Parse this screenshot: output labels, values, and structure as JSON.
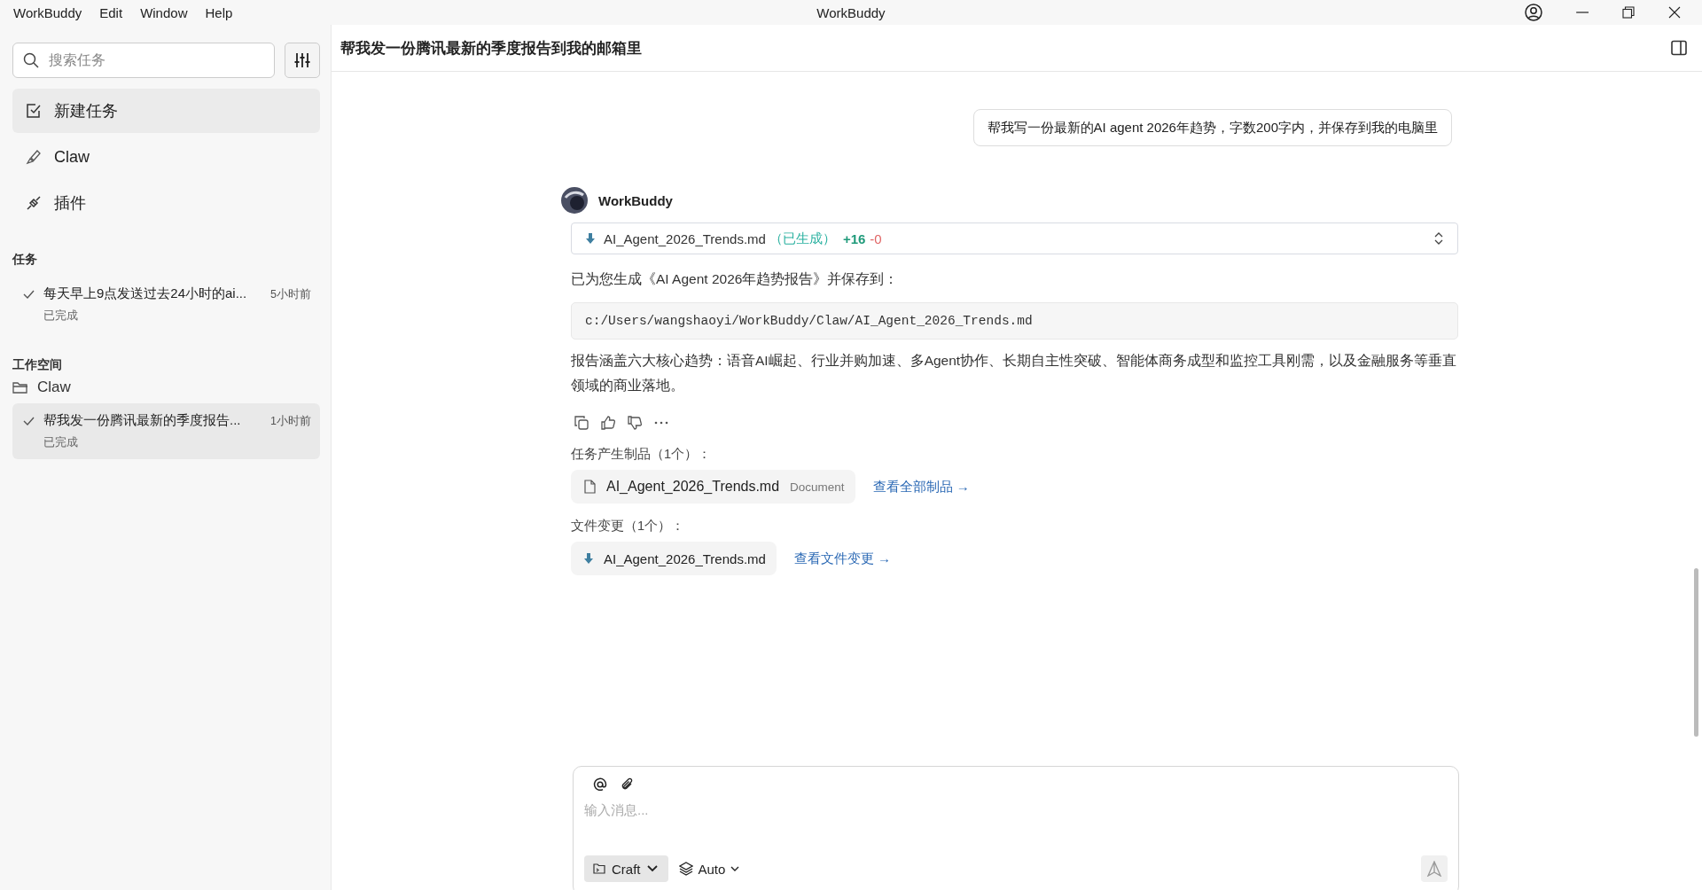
{
  "menu": [
    "WorkBuddy",
    "Edit",
    "Window",
    "Help"
  ],
  "window": {
    "title": "WorkBuddy"
  },
  "sidebar": {
    "search": {
      "placeholder": "搜索任务"
    },
    "nav": [
      {
        "kind": "new-task",
        "label": "新建任务",
        "selected": true
      },
      {
        "kind": "claw",
        "label": "Claw",
        "selected": false
      },
      {
        "kind": "plugin",
        "label": "插件",
        "selected": false
      }
    ],
    "tasks_heading": "任务",
    "tasks": [
      {
        "title": "每天早上9点发送过去24小时的ai...",
        "time": "5小时前",
        "status": "已完成",
        "selected": false
      }
    ],
    "workspace_heading": "工作空间",
    "workspace": {
      "name": "Claw",
      "tasks": [
        {
          "title": "帮我发一份腾讯最新的季度报告...",
          "time": "1小时前",
          "status": "已完成",
          "selected": true
        }
      ]
    }
  },
  "chat": {
    "title": "帮我发一份腾讯最新的季度报告到我的邮箱里",
    "user_message": "帮我写一份最新的AI agent 2026年趋势，字数200字内，并保存到我的电脑里",
    "reply": {
      "sender": "WorkBuddy",
      "file_bar": {
        "file": "AI_Agent_2026_Trends.md",
        "status": "（已生成）",
        "added": "+16",
        "removed": "-0"
      },
      "intro": "已为您生成《AI Agent 2026年趋势报告》并保存到：",
      "path": "c:/Users/wangshaoyi/WorkBuddy/Claw/AI_Agent_2026_Trends.md",
      "summary": "报告涵盖六大核心趋势：语音AI崛起、行业并购加速、多Agent协作、长期自主性突破、智能体商务成型和监控工具刚需，以及金融服务等垂直领域的商业落地。",
      "artifacts_heading": "任务产生制品（1个）：",
      "artifact": {
        "name": "AI_Agent_2026_Trends.md",
        "type": "Document"
      },
      "artifacts_link": "查看全部制品 →",
      "changes_heading": "文件变更（1个）：",
      "change": {
        "name": "AI_Agent_2026_Trends.md"
      },
      "changes_link": "查看文件变更 →"
    }
  },
  "composer": {
    "placeholder": "输入消息...",
    "mode": "Craft",
    "model": "Auto"
  }
}
